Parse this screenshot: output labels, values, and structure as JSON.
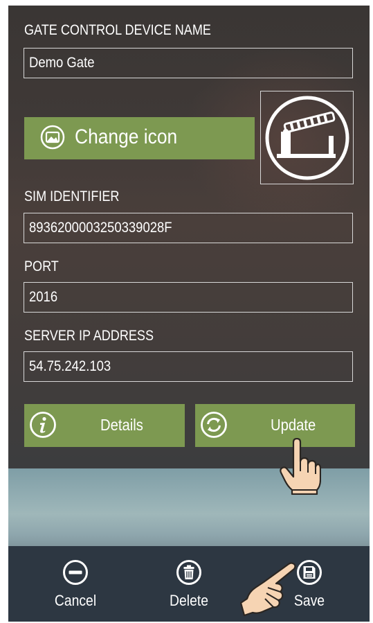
{
  "form": {
    "device_name_label": "GATE CONTROL DEVICE NAME",
    "device_name_value": "Demo Gate",
    "change_icon_label": "Change icon",
    "sim_label": "SIM IDENTIFIER",
    "sim_value": "8936200003250339028F",
    "port_label": "PORT",
    "port_value": "2016",
    "server_ip_label": "SERVER IP ADDRESS",
    "server_ip_value": "54.75.242.103"
  },
  "actions": {
    "details_label": "Details",
    "update_label": "Update"
  },
  "bottom_bar": {
    "cancel_label": "Cancel",
    "delete_label": "Delete",
    "save_label": "Save"
  },
  "icons": {
    "change_icon": "image-icon",
    "preview": "gate-barrier-icon",
    "details": "info-icon",
    "update": "refresh-icon",
    "cancel": "minus-circle-icon",
    "delete": "trash-icon",
    "save": "floppy-disk-icon",
    "pointer": "hand-pointer-icon"
  },
  "colors": {
    "accent_green": "#7d9951",
    "bottom_bar": "#2d3742"
  }
}
